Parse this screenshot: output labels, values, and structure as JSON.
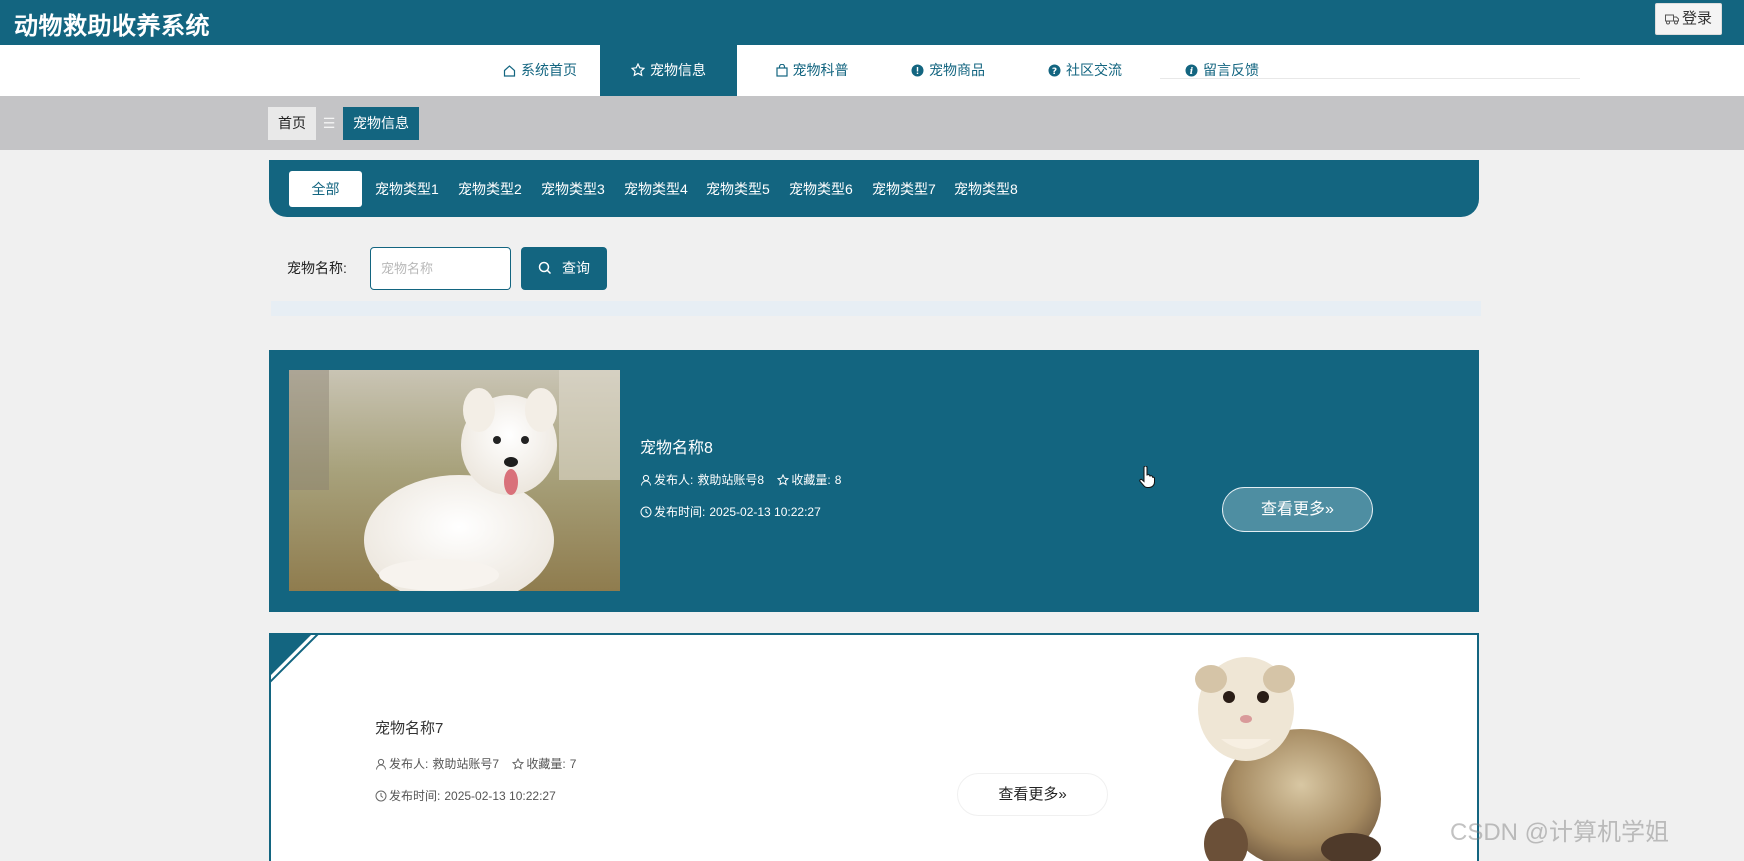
{
  "header": {
    "title": "动物救助收养系统",
    "login_label": "登录"
  },
  "nav": {
    "items": [
      {
        "label": "系统首页",
        "icon": "home-icon"
      },
      {
        "label": "宠物信息",
        "icon": "star-icon",
        "active": true
      },
      {
        "label": "宠物科普",
        "icon": "bag-icon"
      },
      {
        "label": "宠物商品",
        "icon": "exclamation-circle-icon"
      },
      {
        "label": "社区交流",
        "icon": "question-circle-icon"
      },
      {
        "label": "留言反馈",
        "icon": "info-circle-icon"
      }
    ]
  },
  "breadcrumb": {
    "home": "首页",
    "separator": "☰",
    "current": "宠物信息"
  },
  "types": [
    "全部",
    "宠物类型1",
    "宠物类型2",
    "宠物类型3",
    "宠物类型4",
    "宠物类型5",
    "宠物类型6",
    "宠物类型7",
    "宠物类型8"
  ],
  "search": {
    "label": "宠物名称:",
    "placeholder": "宠物名称",
    "button_label": "查询"
  },
  "cards": [
    {
      "name": "宠物名称8",
      "publisher_label": "发布人:",
      "publisher": "救助站账号8",
      "favorites_label": "收藏量:",
      "favorites": "8",
      "time_label": "发布时间:",
      "time": "2025-02-13 10:22:27",
      "more_label": "查看更多»"
    },
    {
      "name": "宠物名称7",
      "publisher_label": "发布人:",
      "publisher": "救助站账号7",
      "favorites_label": "收藏量:",
      "favorites": "7",
      "time_label": "发布时间:",
      "time": "2025-02-13 10:22:27",
      "more_label": "查看更多»"
    }
  ],
  "watermark": "CSDN @计算机学姐",
  "colors": {
    "primary": "#136580",
    "background": "#f0f0f0",
    "breadcrumb_band": "#c4c4c6"
  }
}
